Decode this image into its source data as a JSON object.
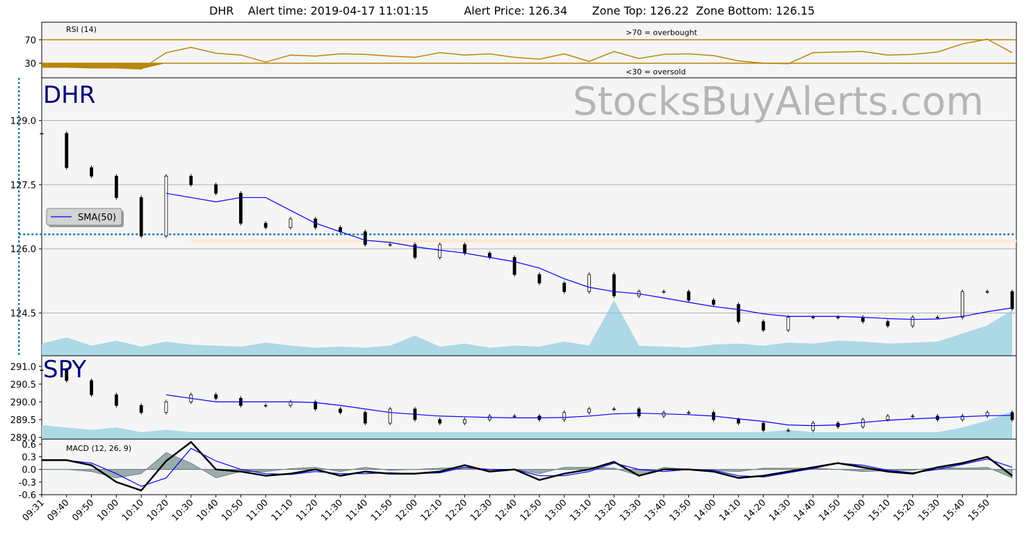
{
  "header": {
    "title_text": "DHR    Alert time: 2019-04-17 11:01:15          Alert Price: 126.34       Zone Top: 126.22  Zone Bottom: 126.15"
  },
  "watermark": "StocksBuyAlerts.com",
  "colors": {
    "panel_bg": "#f5f5f5",
    "rsi_line": "#b8860b",
    "sma": "#0000ff",
    "volume": "#add8e6",
    "alert_line": "#1f77b4",
    "ticker_label": "#000080",
    "zone": "#fde9d0",
    "grid": "#b0b0b0"
  },
  "chart_data": [
    {
      "id": "rsi",
      "type": "line",
      "label": "RSI (14)",
      "yticks": [
        70,
        30
      ],
      "ylim": [
        5,
        100
      ],
      "thresholds": [
        {
          "value": 70,
          "text": ">70 = overbought"
        },
        {
          "value": 30,
          "text": "<30 = oversold"
        }
      ],
      "x": [
        "09:31",
        "09:40",
        "09:50",
        "10:00",
        "10:10",
        "10:20",
        "10:30",
        "10:40",
        "10:50",
        "11:00",
        "11:10",
        "11:20",
        "11:30",
        "11:40",
        "11:50",
        "12:00",
        "12:10",
        "12:20",
        "12:30",
        "12:40",
        "12:50",
        "13:00",
        "13:10",
        "13:20",
        "13:30",
        "13:40",
        "13:50",
        "14:00",
        "14:10",
        "14:20",
        "14:30",
        "14:40",
        "14:50",
        "15:00",
        "15:10",
        "15:20",
        "15:30",
        "15:40",
        "15:50",
        "15:58"
      ],
      "values": [
        23,
        23,
        22,
        22,
        20,
        48,
        57,
        47,
        44,
        32,
        44,
        42,
        46,
        45,
        42,
        40,
        48,
        44,
        46,
        40,
        37,
        46,
        33,
        50,
        38,
        45,
        46,
        43,
        34,
        30,
        29,
        48,
        49,
        50,
        44,
        45,
        49,
        63,
        71,
        48
      ]
    },
    {
      "id": "dhr",
      "type": "line",
      "ticker": "DHR",
      "ylim": [
        123.5,
        130.0
      ],
      "yticks": [
        "129.0",
        "127.5",
        "126.0",
        "124.5"
      ],
      "zone": {
        "top": 126.22,
        "bottom": 126.15
      },
      "alert": {
        "time": "11:01",
        "price": 126.34
      },
      "legend": "SMA(50)",
      "x": [
        "09:31",
        "09:40",
        "09:50",
        "10:00",
        "10:10",
        "10:20",
        "10:30",
        "10:40",
        "10:50",
        "11:00",
        "11:10",
        "11:20",
        "11:30",
        "11:40",
        "11:50",
        "12:00",
        "12:10",
        "12:20",
        "12:30",
        "12:40",
        "12:50",
        "13:00",
        "13:10",
        "13:20",
        "13:30",
        "13:40",
        "13:50",
        "14:00",
        "14:10",
        "14:20",
        "14:30",
        "14:40",
        "14:50",
        "15:00",
        "15:10",
        "15:20",
        "15:30",
        "15:40",
        "15:50",
        "15:58"
      ],
      "close": [
        128.7,
        127.9,
        127.7,
        127.2,
        126.3,
        127.7,
        127.5,
        127.3,
        126.6,
        126.5,
        126.7,
        126.5,
        126.4,
        126.1,
        126.1,
        125.8,
        126.1,
        125.9,
        125.8,
        125.4,
        125.2,
        125.0,
        125.4,
        124.9,
        125.0,
        125.0,
        124.8,
        124.7,
        124.3,
        124.1,
        124.4,
        124.4,
        124.4,
        124.3,
        124.2,
        124.4,
        124.4,
        125.0,
        125.0,
        124.6
      ],
      "sma": [
        null,
        null,
        null,
        null,
        null,
        127.3,
        127.2,
        127.1,
        127.2,
        127.2,
        126.9,
        126.6,
        126.4,
        126.2,
        126.15,
        126.05,
        125.97,
        125.9,
        125.8,
        125.7,
        125.55,
        125.3,
        125.1,
        125.0,
        124.95,
        124.85,
        124.75,
        124.65,
        124.58,
        124.48,
        124.42,
        124.42,
        124.42,
        124.4,
        124.37,
        124.35,
        124.36,
        124.42,
        124.53,
        124.62
      ],
      "volume": [
        12,
        18,
        10,
        15,
        9,
        14,
        11,
        10,
        9,
        13,
        10,
        8,
        9,
        8,
        10,
        20,
        9,
        12,
        8,
        10,
        9,
        14,
        10,
        55,
        10,
        9,
        8,
        11,
        12,
        10,
        13,
        12,
        15,
        14,
        12,
        13,
        14,
        22,
        30,
        45
      ]
    },
    {
      "id": "spy",
      "type": "line",
      "ticker": "SPY",
      "ylim": [
        288.95,
        291.3
      ],
      "yticks": [
        "291.0",
        "290.5",
        "290.0",
        "289.5",
        "289.0"
      ],
      "x": [
        "09:31",
        "09:40",
        "09:50",
        "10:00",
        "10:10",
        "10:20",
        "10:30",
        "10:40",
        "10:50",
        "11:00",
        "11:10",
        "11:20",
        "11:30",
        "11:40",
        "11:50",
        "12:00",
        "12:10",
        "12:20",
        "12:30",
        "12:40",
        "12:50",
        "13:00",
        "13:10",
        "13:20",
        "13:30",
        "13:40",
        "13:50",
        "14:00",
        "14:10",
        "14:20",
        "14:30",
        "14:40",
        "14:50",
        "15:00",
        "15:10",
        "15:20",
        "15:30",
        "15:40",
        "15:50",
        "15:58"
      ],
      "close": [
        290.9,
        290.6,
        290.2,
        289.9,
        289.7,
        290.0,
        290.2,
        290.1,
        289.9,
        289.9,
        290.0,
        289.8,
        289.7,
        289.4,
        289.8,
        289.5,
        289.4,
        289.5,
        289.6,
        289.6,
        289.5,
        289.7,
        289.8,
        289.8,
        289.6,
        289.7,
        289.7,
        289.5,
        289.4,
        289.2,
        289.2,
        289.4,
        289.3,
        289.5,
        289.6,
        289.6,
        289.5,
        289.6,
        289.7,
        289.5
      ],
      "sma": [
        null,
        null,
        null,
        null,
        null,
        290.2,
        290.1,
        290.0,
        290.0,
        290.0,
        290.0,
        289.98,
        289.9,
        289.8,
        289.7,
        289.65,
        289.6,
        289.58,
        289.56,
        289.55,
        289.55,
        289.56,
        289.6,
        289.66,
        289.68,
        289.66,
        289.64,
        289.6,
        289.52,
        289.45,
        289.35,
        289.33,
        289.35,
        289.42,
        289.48,
        289.52,
        289.55,
        289.58,
        289.61,
        289.62
      ],
      "volume": [
        6,
        5,
        4,
        5,
        3,
        4,
        3,
        3,
        3,
        3,
        3,
        3,
        3,
        3,
        3,
        3,
        3,
        3,
        3,
        3,
        3,
        3,
        3,
        3,
        3,
        3,
        3,
        3,
        3,
        3,
        4,
        3,
        3,
        3,
        3,
        3,
        3,
        5,
        8,
        12
      ]
    },
    {
      "id": "macd",
      "type": "line",
      "label": "MACD (12, 26, 9)",
      "ylim": [
        -0.6,
        0.72
      ],
      "yticks": [
        "0.6",
        "0.3",
        "0.0",
        "-0.3",
        "-0.6"
      ],
      "x": [
        "09:31",
        "09:40",
        "09:50",
        "10:00",
        "10:10",
        "10:20",
        "10:30",
        "10:40",
        "10:50",
        "11:00",
        "11:10",
        "11:20",
        "11:30",
        "11:40",
        "11:50",
        "12:00",
        "12:10",
        "12:20",
        "12:30",
        "12:40",
        "12:50",
        "13:00",
        "13:10",
        "13:20",
        "13:30",
        "13:40",
        "13:50",
        "14:00",
        "14:10",
        "14:20",
        "14:30",
        "14:40",
        "14:50",
        "15:00",
        "15:10",
        "15:20",
        "15:30",
        "15:40",
        "15:50",
        "15:58"
      ],
      "macd": [
        0.22,
        0.22,
        0.1,
        -0.3,
        -0.5,
        0.2,
        0.65,
        0.0,
        -0.05,
        -0.15,
        -0.1,
        0.0,
        -0.15,
        -0.05,
        -0.1,
        -0.1,
        -0.05,
        0.1,
        -0.05,
        0.0,
        -0.25,
        -0.1,
        0.0,
        0.18,
        -0.15,
        0.0,
        0.0,
        -0.05,
        -0.2,
        -0.15,
        -0.05,
        0.05,
        0.15,
        0.05,
        -0.05,
        -0.1,
        0.05,
        0.15,
        0.3,
        -0.15
      ],
      "signal": [
        0.22,
        0.22,
        0.15,
        -0.1,
        -0.4,
        -0.2,
        0.5,
        0.2,
        0.0,
        -0.1,
        -0.12,
        -0.05,
        -0.1,
        -0.1,
        -0.08,
        -0.1,
        -0.08,
        0.05,
        0.0,
        0.0,
        -0.15,
        -0.15,
        -0.05,
        0.15,
        0.0,
        -0.05,
        0.0,
        -0.02,
        -0.15,
        -0.18,
        -0.08,
        0.02,
        0.15,
        0.1,
        -0.02,
        -0.08,
        0.0,
        0.12,
        0.25,
        0.05
      ]
    }
  ],
  "x_tick_labels": [
    "09:31",
    "09:40",
    "09:50",
    "10:00",
    "10:10",
    "10:20",
    "10:30",
    "10:40",
    "10:50",
    "11:00",
    "11:10",
    "11:20",
    "11:30",
    "11:40",
    "11:50",
    "12:00",
    "12:10",
    "12:20",
    "12:30",
    "12:40",
    "12:50",
    "13:00",
    "13:10",
    "13:20",
    "13:30",
    "13:40",
    "13:50",
    "14:00",
    "14:10",
    "14:20",
    "14:30",
    "14:40",
    "14:50",
    "15:00",
    "15:10",
    "15:20",
    "15:30",
    "15:40",
    "15:50"
  ]
}
